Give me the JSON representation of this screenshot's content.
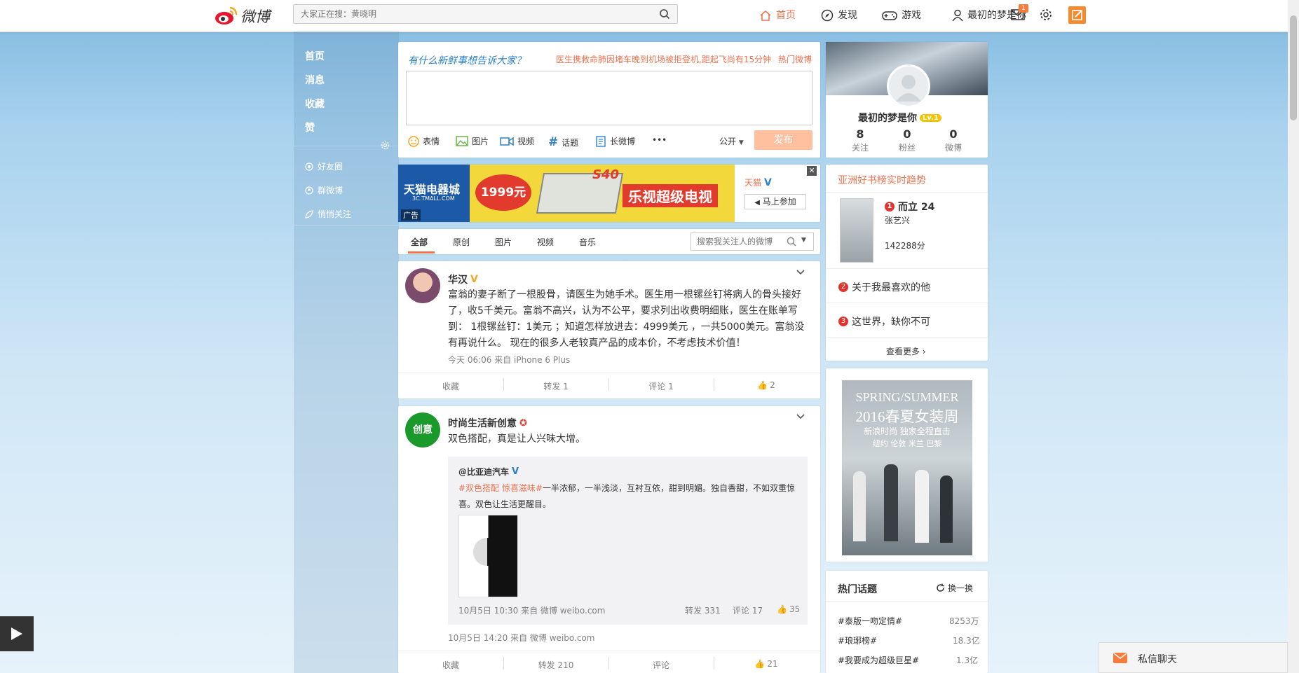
{
  "header": {
    "logo_text": "微博",
    "search_placeholder": "大家正在搜：黄晓明",
    "nav": {
      "home": "首页",
      "discover": "发现",
      "games": "游戏",
      "user": "最初的梦是你"
    },
    "message_badge": "1"
  },
  "leftnav": {
    "items": [
      "首页",
      "消息",
      "收藏",
      "赞"
    ],
    "subs": [
      "好友圈",
      "群微博",
      "悄悄关注"
    ]
  },
  "compose": {
    "prompt": "有什么新鲜事想告诉大家？",
    "hot_link": "医生携救命肺因堵车晚到机场被拒登机,距起飞尚有15分钟",
    "hot_weibo": "热门微博",
    "tools": [
      "表情",
      "图片",
      "视频",
      "话题",
      "长微博"
    ],
    "more": "•••",
    "visibility": "公开",
    "publish": "发布"
  },
  "ad": {
    "store": "天猫电器城",
    "store_sub": "3C.TMALL.COM",
    "ad_label": "广告",
    "price": "1999元",
    "product": "乐视超级电视",
    "model": "S40",
    "brand": "天猫",
    "join": "马上参加"
  },
  "filters": {
    "tabs": [
      "全部",
      "原创",
      "图片",
      "视频",
      "音乐"
    ],
    "search_placeholder": "搜索我关注人的微博"
  },
  "posts": [
    {
      "author": "华汉",
      "text": "富翁的妻子断了一根股骨，请医生为她手术。医生用一根镙丝钉将病人的骨头接好了，收5千美元。富翁不高兴，认为不公平，要求列出收费明细账，医生在账单写到： 1根镙丝钉：1美元 ；知道怎样放进去：4999美元 ，一共5000美元。富翁没有再说什么。 现在的很多人老较真产品的成本价，不考虑技术价值！",
      "meta": "今天 06:06 来自 iPhone 6 Plus",
      "actions": {
        "fav": "收藏",
        "repost": "转发 1",
        "comment": "评论 1",
        "like": "2"
      }
    },
    {
      "author": "时尚生活新创意",
      "avatar_text": "创意",
      "text": "双色搭配，真是让人兴味大增。",
      "repost": {
        "author": "@比亚迪汽车",
        "tags": "#双色搭配 惊喜滋味#",
        "text": "一半浓郁，一半浅淡，互衬互依，甜到明媚。独自香甜，不如双重惊喜。双色让生活更醒目。",
        "meta": "10月5日 10:30 来自 微博 weibo.com",
        "repost_count": "转发 331",
        "comment_count": "评论 17",
        "like_count": "35"
      },
      "meta": "10月5日 14:20 来自 微博 weibo.com",
      "actions": {
        "fav": "收藏",
        "repost": "转发 210",
        "comment": "评论",
        "like": "21"
      }
    }
  ],
  "profile": {
    "name": "最初的梦是你",
    "level": "Lv.1",
    "stats": [
      {
        "num": "8",
        "label": "关注"
      },
      {
        "num": "0",
        "label": "粉丝"
      },
      {
        "num": "0",
        "label": "微博"
      }
    ]
  },
  "ranking": {
    "title": "亚洲好书榜实时趋势",
    "items": [
      {
        "rank": "1",
        "title": "而立 24",
        "author": "张艺兴",
        "score": "142288分"
      },
      {
        "rank": "2",
        "title": "关于我最喜欢的他"
      },
      {
        "rank": "3",
        "title": "这世界，缺你不可"
      }
    ],
    "more": "查看更多"
  },
  "promo": {
    "line1": "SPRING/SUMMER",
    "line2": "2016春夏女装周",
    "line3": "新浪时尚 独家全程直击",
    "line4": "纽约 伦敦 米兰 巴黎"
  },
  "topics": {
    "title": "热门话题",
    "refresh": "换一换",
    "items": [
      {
        "name": "#泰版一吻定情#",
        "count": "8253万"
      },
      {
        "name": "#琅琊榜#",
        "count": "18.3亿"
      },
      {
        "name": "#我要成为超级巨星#",
        "count": "1.3亿"
      }
    ]
  },
  "chat": {
    "label": "私信聊天"
  },
  "colors": {
    "accent": "#eb7350",
    "link": "#2d82c9",
    "bg_top": "#7fb8df"
  }
}
